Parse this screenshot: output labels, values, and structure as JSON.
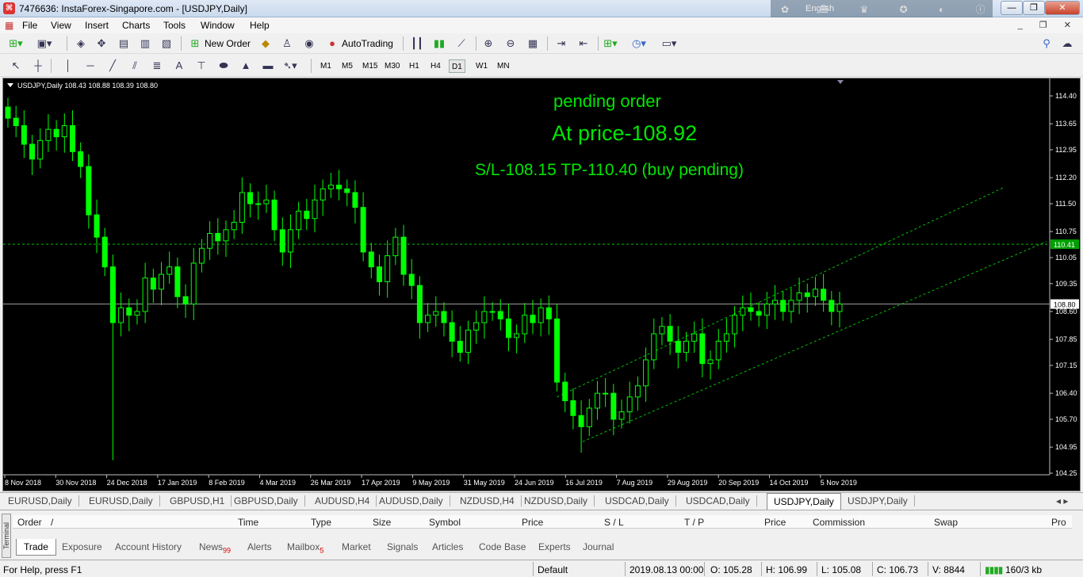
{
  "window": {
    "title": "7476636: InstaForex-Singapore.com - [USDJPY,Daily]",
    "language": "English",
    "minimize": "—",
    "maximize": "❐",
    "close": "✕"
  },
  "menu": [
    "File",
    "View",
    "Insert",
    "Charts",
    "Tools",
    "Window",
    "Help"
  ],
  "toolbar": {
    "new_order": "New Order",
    "autotrading": "AutoTrading",
    "timeframes": [
      "M1",
      "M5",
      "M15",
      "M30",
      "H1",
      "H4",
      "D1",
      "W1",
      "MN"
    ],
    "active_timeframe": "D1"
  },
  "chart": {
    "header": "USDJPY,Daily  108.43 108.88 108.39 108.80",
    "annotations": {
      "line1": "pending order",
      "line2": "At price-108.92",
      "line3": "S/L-108.15  TP-110.40 (buy pending)"
    },
    "colors": {
      "background": "#000000",
      "candle": "#00ff00",
      "text": "#00e600",
      "bid_line": "#a0a0a0",
      "level_line": "#00c000"
    },
    "current_price_label": "108.80",
    "level_price_label": "110.41"
  },
  "chart_data": {
    "type": "line",
    "title": "",
    "ylim": [
      104.25,
      114.4
    ],
    "y_ticks": [
      "114.40",
      "113.65",
      "112.95",
      "112.20",
      "111.50",
      "110.75",
      "110.05",
      "109.35",
      "108.60",
      "107.85",
      "107.15",
      "106.40",
      "105.70",
      "104.95",
      "104.25"
    ],
    "x_ticks": [
      "8 Nov 2018",
      "30 Nov 2018",
      "24 Dec 2018",
      "17 Jan 2019",
      "8 Feb 2019",
      "4 Mar 2019",
      "26 Mar 2019",
      "17 Apr 2019",
      "9 May 2019",
      "31 May 2019",
      "24 Jun 2019",
      "16 Jul 2019",
      "7 Aug 2019",
      "29 Aug 2019",
      "20 Sep 2019",
      "14 Oct 2019",
      "5 Nov 2019"
    ],
    "series": [
      {
        "values": [
          113.8,
          113.6,
          113.1,
          112.7,
          113.2,
          113.5,
          113.3,
          113.6,
          112.9,
          112.5,
          111.2,
          110.6,
          109.8,
          108.3,
          108.7,
          108.5,
          108.6,
          109.5,
          109.2,
          109.6,
          109.8,
          109.0,
          108.8,
          109.9,
          110.3,
          110.7,
          110.5,
          110.8,
          111.0,
          111.8,
          111.5,
          111.5,
          111.6,
          110.8,
          110.2,
          110.8,
          111.3,
          111.1,
          111.6,
          111.9,
          112.0,
          111.9,
          111.8,
          111.4,
          110.2,
          109.8,
          109.4,
          110.1,
          110.6,
          109.6,
          109.3,
          108.3,
          108.5,
          108.6,
          108.3,
          107.8,
          107.5,
          108.1,
          108.3,
          108.6,
          108.6,
          108.4,
          107.9,
          108.0,
          108.5,
          108.3,
          108.7,
          108.4,
          106.7,
          106.2,
          105.8,
          105.5,
          106.0,
          106.4,
          106.4,
          105.7,
          105.9,
          106.3,
          106.6,
          107.3,
          108.0,
          108.2,
          107.8,
          107.5,
          107.8,
          108.0,
          107.2,
          107.3,
          107.8,
          108.0,
          108.5,
          108.7,
          108.6,
          108.5,
          108.8,
          108.9,
          108.6,
          108.9,
          109.1,
          109.0,
          109.2,
          108.9,
          108.6,
          108.8
        ]
      }
    ],
    "levels": [
      {
        "type": "horizontal",
        "value": 110.41
      },
      {
        "type": "bid",
        "value": 108.8
      }
    ],
    "channel": {
      "upper_start": {
        "x": "7 Aug 2019",
        "y": 106.3
      },
      "lower_start": {
        "x": "14 Aug 2019",
        "y": 105.1
      },
      "direction": "up"
    }
  },
  "symbol_tabs": [
    "EURUSD,Daily",
    "EURUSD,Daily",
    "GBPUSD,H1",
    "GBPUSD,Daily",
    "AUDUSD,H4",
    "AUDUSD,Daily",
    "NZDUSD,H4",
    "NZDUSD,Daily",
    "USDCAD,Daily",
    "USDCAD,Daily",
    "USDJPY,Daily",
    "USDJPY,Daily"
  ],
  "active_symbol_tab": 10,
  "terminal": {
    "side_label": "Terminal",
    "columns": [
      "Order",
      "/",
      "Time",
      "Type",
      "Size",
      "Symbol",
      "Price",
      "S / L",
      "T / P",
      "Price",
      "Commission",
      "Swap",
      "Pro"
    ],
    "tabs": [
      {
        "label": "Trade",
        "badge": ""
      },
      {
        "label": "Exposure",
        "badge": ""
      },
      {
        "label": "Account History",
        "badge": ""
      },
      {
        "label": "News",
        "badge": "99"
      },
      {
        "label": "Alerts",
        "badge": ""
      },
      {
        "label": "Mailbox",
        "badge": "5"
      },
      {
        "label": "Market",
        "badge": ""
      },
      {
        "label": "Signals",
        "badge": ""
      },
      {
        "label": "Articles",
        "badge": ""
      },
      {
        "label": "Code Base",
        "badge": ""
      },
      {
        "label": "Experts",
        "badge": ""
      },
      {
        "label": "Journal",
        "badge": ""
      }
    ]
  },
  "status": {
    "help": "For Help, press F1",
    "profile": "Default",
    "datetime": "2019.08.13 00:00",
    "open": "O: 105.28",
    "high": "H: 106.99",
    "low": "L: 105.08",
    "close": "C: 106.73",
    "volume": "V: 8844",
    "traffic": "160/3 kb"
  }
}
